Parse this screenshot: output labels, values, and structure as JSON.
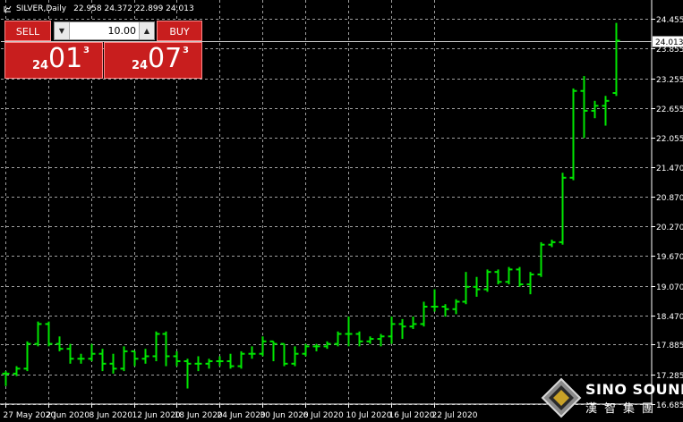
{
  "header": {
    "symbol": "SILVER,Daily",
    "ohlc": "22.958 24.372 22.899 24.013"
  },
  "trade_panel": {
    "sell_label": "SELL",
    "buy_label": "BUY",
    "lot_value": "10.00",
    "sell_quote": {
      "prefix": "24",
      "big": "01",
      "sup": "3"
    },
    "buy_quote": {
      "prefix": "24",
      "big": "07",
      "sup": "3"
    }
  },
  "logo": {
    "name": "SINO SOUND",
    "chinese": "漢智集團"
  },
  "chart_data": {
    "type": "bar",
    "style": "ohlc",
    "colors": {
      "bars": "#00e600",
      "grid": "#c8c8c8",
      "axis_text": "#ffffff",
      "background": "#000000",
      "bid_line": "#c8c8c8"
    },
    "grid": true,
    "current_price": "24.013",
    "y_ticks": [
      "24.455",
      "23.855",
      "23.255",
      "22.655",
      "22.055",
      "21.470",
      "20.870",
      "20.270",
      "19.670",
      "19.070",
      "18.470",
      "17.885",
      "17.285",
      "16.685"
    ],
    "ylim": [
      16.6,
      24.6
    ],
    "x_ticks": [
      "27 May 2020",
      "2 Jun 2020",
      "8 Jun 2020",
      "12 Jun 2020",
      "18 Jun 2020",
      "24 Jun 2020",
      "30 Jun 2020",
      "6 Jul 2020",
      "10 Jul 2020",
      "16 Jul 2020",
      "22 Jul 2020"
    ],
    "ohlc": [
      [
        17.3,
        17.35,
        17.05,
        17.3
      ],
      [
        17.3,
        17.45,
        17.25,
        17.4
      ],
      [
        17.4,
        17.95,
        17.35,
        17.9
      ],
      [
        17.9,
        18.35,
        17.85,
        18.3
      ],
      [
        18.3,
        18.35,
        17.85,
        17.9
      ],
      [
        17.9,
        18.05,
        17.75,
        17.8
      ],
      [
        17.8,
        17.9,
        17.5,
        17.6
      ],
      [
        17.6,
        17.7,
        17.5,
        17.6
      ],
      [
        17.6,
        17.9,
        17.55,
        17.7
      ],
      [
        17.7,
        17.8,
        17.35,
        17.5
      ],
      [
        17.5,
        17.7,
        17.3,
        17.4
      ],
      [
        17.4,
        17.85,
        17.35,
        17.75
      ],
      [
        17.75,
        17.75,
        17.45,
        17.6
      ],
      [
        17.6,
        17.8,
        17.5,
        17.65
      ],
      [
        17.65,
        18.15,
        17.55,
        18.1
      ],
      [
        18.1,
        18.15,
        17.45,
        17.65
      ],
      [
        17.65,
        17.75,
        17.45,
        17.55
      ],
      [
        17.55,
        17.6,
        17.0,
        17.5
      ],
      [
        17.5,
        17.65,
        17.35,
        17.5
      ],
      [
        17.5,
        17.6,
        17.4,
        17.55
      ],
      [
        17.55,
        17.65,
        17.45,
        17.55
      ],
      [
        17.55,
        17.7,
        17.4,
        17.45
      ],
      [
        17.45,
        17.75,
        17.4,
        17.7
      ],
      [
        17.7,
        17.85,
        17.6,
        17.7
      ],
      [
        17.7,
        18.05,
        17.65,
        17.95
      ],
      [
        17.95,
        17.95,
        17.55,
        17.9
      ],
      [
        17.9,
        17.9,
        17.45,
        17.5
      ],
      [
        17.5,
        17.85,
        17.45,
        17.7
      ],
      [
        17.7,
        17.9,
        17.65,
        17.85
      ],
      [
        17.85,
        17.9,
        17.75,
        17.85
      ],
      [
        17.85,
        17.95,
        17.8,
        17.9
      ],
      [
        17.9,
        18.15,
        17.85,
        18.1
      ],
      [
        18.1,
        18.45,
        17.85,
        18.1
      ],
      [
        18.1,
        18.15,
        17.85,
        17.95
      ],
      [
        17.95,
        18.05,
        17.9,
        18.0
      ],
      [
        18.0,
        18.1,
        17.85,
        18.05
      ],
      [
        18.05,
        18.45,
        17.9,
        18.3
      ],
      [
        18.3,
        18.4,
        18.0,
        18.25
      ],
      [
        18.25,
        18.45,
        18.2,
        18.3
      ],
      [
        18.3,
        18.75,
        18.25,
        18.65
      ],
      [
        18.65,
        19.0,
        18.55,
        18.65
      ],
      [
        18.65,
        18.7,
        18.45,
        18.6
      ],
      [
        18.6,
        18.8,
        18.5,
        18.75
      ],
      [
        18.75,
        19.35,
        18.7,
        19.05
      ],
      [
        19.05,
        19.25,
        18.85,
        19.0
      ],
      [
        19.0,
        19.4,
        18.95,
        19.35
      ],
      [
        19.35,
        19.4,
        19.1,
        19.15
      ],
      [
        19.15,
        19.45,
        19.1,
        19.4
      ],
      [
        19.4,
        19.45,
        19.05,
        19.1
      ],
      [
        19.1,
        19.35,
        18.9,
        19.3
      ],
      [
        19.3,
        19.95,
        19.25,
        19.9
      ],
      [
        19.9,
        20.0,
        19.85,
        19.95
      ],
      [
        19.95,
        21.35,
        19.9,
        21.25
      ],
      [
        21.25,
        23.05,
        21.2,
        23.0
      ],
      [
        23.0,
        23.3,
        22.05,
        22.6
      ],
      [
        22.6,
        22.8,
        22.45,
        22.7
      ],
      [
        22.7,
        22.9,
        22.3,
        22.8
      ],
      [
        22.958,
        24.372,
        22.899,
        24.013
      ]
    ]
  }
}
